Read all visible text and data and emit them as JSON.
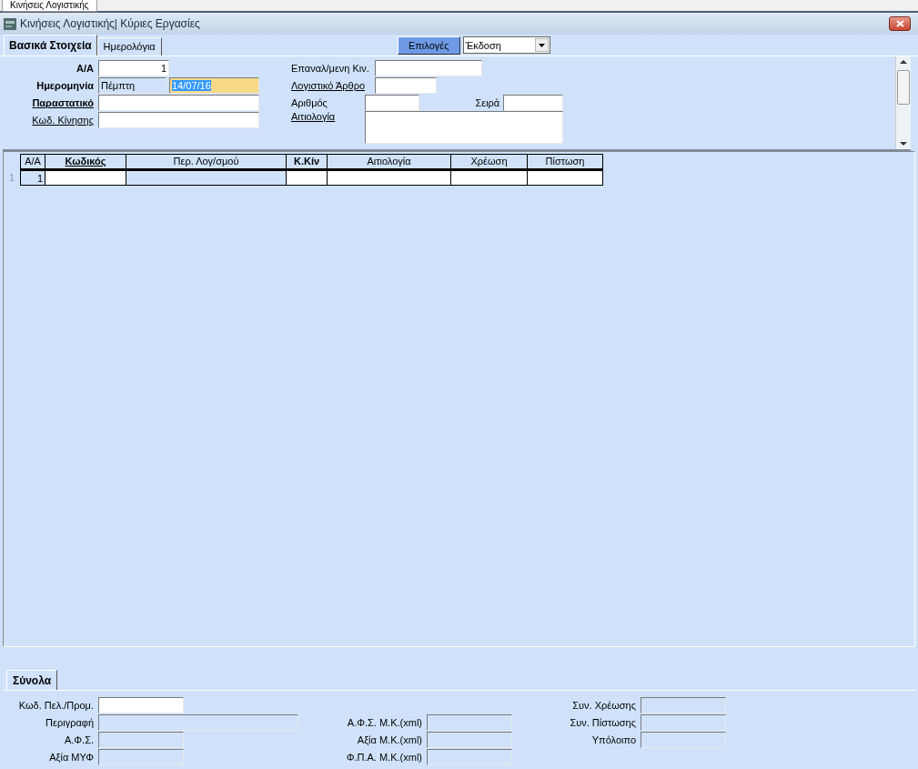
{
  "window": {
    "tab": "Κινήσεις Λογιστικής",
    "title": "Κινήσεις Λογιστικής| Κύριες Εργασίες"
  },
  "tabs": [
    {
      "label": "Βασικά Στοιχεία",
      "selected": true
    },
    {
      "label": "Ημερολόγια",
      "selected": false
    }
  ],
  "options_button": "Επιλογές",
  "dropdown": {
    "value": "Έκδοση"
  },
  "form": {
    "left": [
      {
        "label": "Α/Α",
        "bold": true,
        "link": false,
        "inputs": [
          {
            "value": "1",
            "disabled": false,
            "selected": false
          }
        ]
      },
      {
        "label": "Ημερομηνία",
        "bold": true,
        "link": false,
        "inputs": [
          {
            "value": "Πέμπτη",
            "disabled": true,
            "selected": false
          },
          {
            "value": "14/07/16",
            "disabled": false,
            "selected": true
          }
        ]
      },
      {
        "label": "Παραστατικό",
        "bold": true,
        "link": true,
        "inputs": [
          {
            "disabled": false,
            "selected": false
          }
        ]
      },
      {
        "label": "Κωδ. Κίνησης",
        "bold": false,
        "link": true,
        "inputs": [
          {
            "disabled": false,
            "selected": false
          }
        ]
      }
    ],
    "right": [
      {
        "label": "Επαναλ/μενη Κιν.",
        "link": false,
        "kind": "text"
      },
      {
        "label": "Λογιστικό Άρθρο",
        "link": true,
        "kind": "text"
      },
      {
        "label": "Αριθμός",
        "link": false,
        "kind": "text",
        "extra_label": "Σειρά"
      },
      {
        "label": "Αιτιολογία",
        "link": true,
        "kind": "memo"
      }
    ]
  },
  "grid": {
    "columns": [
      {
        "label": "Α/Α",
        "bold": false,
        "link": false,
        "readonly": true
      },
      {
        "label": "Κωδικός",
        "bold": true,
        "link": true,
        "readonly": false
      },
      {
        "label": "Περ. Λογ/σμού",
        "bold": false,
        "link": false,
        "readonly": true
      },
      {
        "label": "Κ.Κίν",
        "bold": true,
        "link": false,
        "readonly": false
      },
      {
        "label": "Αιτιολογία",
        "bold": false,
        "link": false,
        "readonly": false
      },
      {
        "label": "Χρέωση",
        "bold": false,
        "link": false,
        "readonly": false
      },
      {
        "label": "Πίστωση",
        "bold": false,
        "link": false,
        "readonly": false
      }
    ],
    "rows": [
      {
        "row_header": "1",
        "cells": [
          "1",
          "",
          "",
          "",
          "",
          "",
          ""
        ]
      }
    ]
  },
  "totals": {
    "tabs": [
      {
        "label": "Σύνολα",
        "selected": true
      }
    ],
    "groups": [
      {
        "fields": [
          {
            "label": "Κωδ. Πελ./Προμ.",
            "disabled": false
          },
          {
            "label": "Περιγραφή",
            "disabled": true
          },
          {
            "label": "Α.Φ.Σ.",
            "disabled": true
          },
          {
            "label": "Αξία ΜΥΦ",
            "disabled": true
          }
        ]
      },
      {
        "fields": [
          {
            "label": "Α.Φ.Σ. Μ.Κ.(xml)",
            "disabled": true
          },
          {
            "label": "Αξία Μ.Κ.(xml)",
            "disabled": true
          },
          {
            "label": "Φ.Π.Α. Μ.Κ.(xml)",
            "disabled": true
          }
        ]
      },
      {
        "fields": [
          {
            "label": "Συν. Χρέωσης",
            "disabled": true
          },
          {
            "label": "Συν. Πίστωσης",
            "disabled": true
          },
          {
            "label": "Υπόλοιπο",
            "disabled": true
          }
        ]
      }
    ]
  }
}
